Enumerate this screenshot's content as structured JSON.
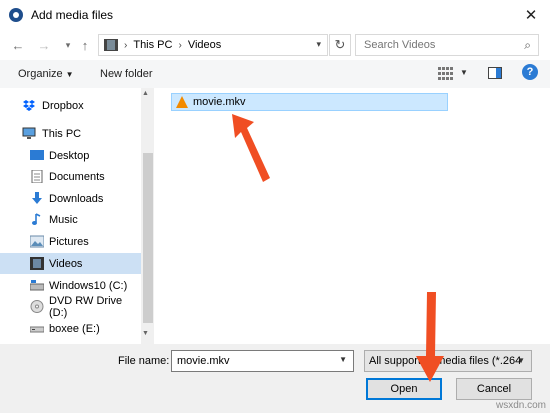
{
  "window": {
    "title": "Add media files"
  },
  "nav": {
    "address": [
      "This PC",
      "Videos"
    ],
    "search_placeholder": "Search Videos"
  },
  "toolbar": {
    "organize": "Organize",
    "new_folder": "New folder"
  },
  "sidebar": {
    "items": [
      {
        "label": "Dropbox",
        "icon": "dropbox-icon"
      },
      {
        "label": "This PC",
        "icon": "computer-icon"
      },
      {
        "label": "Desktop",
        "icon": "desktop-icon"
      },
      {
        "label": "Documents",
        "icon": "documents-icon"
      },
      {
        "label": "Downloads",
        "icon": "downloads-icon"
      },
      {
        "label": "Music",
        "icon": "music-icon"
      },
      {
        "label": "Pictures",
        "icon": "pictures-icon"
      },
      {
        "label": "Videos",
        "icon": "videos-icon"
      },
      {
        "label": "Windows10 (C:)",
        "icon": "drive-icon"
      },
      {
        "label": "DVD RW Drive (D:)",
        "icon": "dvd-icon"
      },
      {
        "label": "boxee (E:)",
        "icon": "usb-drive-icon"
      }
    ],
    "selected": "Videos"
  },
  "files": [
    {
      "name": "movie.mkv",
      "icon": "vlc-icon"
    }
  ],
  "bottom": {
    "file_name_label": "File name:",
    "file_name_value": "movie.mkv",
    "filter": "All supported media files (*.264",
    "open": "Open",
    "cancel": "Cancel"
  },
  "colors": {
    "selection": "#cce8ff",
    "accent": "#0078d7",
    "arrow": "#f04e23"
  },
  "watermark": "wsxdn.com"
}
